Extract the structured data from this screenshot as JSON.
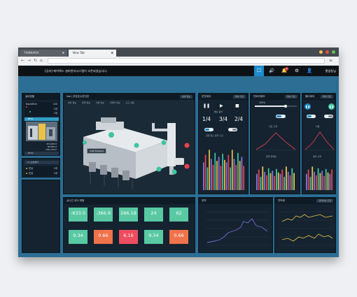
{
  "browser": {
    "tabs": [
      {
        "label": "THINKARIX",
        "close": "✖"
      },
      {
        "label": "New Tab",
        "close": "✖"
      }
    ],
    "window_controls": {
      "colors": [
        "#f5bd4f",
        "#e9504a",
        "#60c153"
      ]
    }
  },
  "header": {
    "notice": "[공지] 에어텍스 설비관리시스템이 오픈되었습니다.",
    "notification_count": "1",
    "user": "홍길동님"
  },
  "left_panel": {
    "title": "설비현황",
    "summary": [
      {
        "label": "Backfilter",
        "value": "100"
      },
      {
        "label": "",
        "value": "1대"
      },
      {
        "label": "",
        "value": "1대"
      }
    ],
    "items": [
      {
        "label": "BF01"
      },
      {
        "label": "BF02"
      }
    ],
    "info_lines": [
      {
        "label": "",
        "value": "BF10B703"
      },
      {
        "label": "",
        "value": "MK3B703"
      },
      {
        "label": "",
        "value": "2020.08.02"
      }
    ],
    "group_title": "LF_보호필터",
    "group_items": [
      {
        "label": "운남",
        "value": "1대"
      },
      {
        "label": "운남",
        "value": "1대"
      }
    ]
  },
  "center_panel": {
    "title": "No1_부영호수운전컨",
    "btn": "설비 정보",
    "toolbar": [
      "필터 정보",
      "압력 정보",
      "차압 정보",
      "인버터 정보",
      "출고 이동"
    ],
    "tooltip": "Inlet Pressure",
    "realtime_title": "실시간 센서 현황",
    "cards": [
      {
        "label": "",
        "value": "-633.0",
        "color": "#58c9a3"
      },
      {
        "label": "",
        "value": "-366.9",
        "color": "#58c9a3"
      },
      {
        "label": "",
        "value": "266.18",
        "color": "#58c9a3"
      },
      {
        "label": "",
        "value": "24",
        "color": "#58c9a3"
      },
      {
        "label": "",
        "value": "62",
        "color": "#58c9a3"
      },
      {
        "label": "",
        "value": "9.34",
        "color": "#58c9a3"
      },
      {
        "label": "",
        "value": "0.66",
        "color": "#f0734b"
      },
      {
        "label": "",
        "value": "6.16",
        "color": "#ee4d5f"
      },
      {
        "label": "",
        "value": "9.34",
        "color": "#58c9a3"
      },
      {
        "label": "",
        "value": "0.66",
        "color": "#f0734b"
      }
    ]
  },
  "operation_panel": {
    "title": "운전제어",
    "btn": "제어 기준",
    "fractions": [
      "1/4",
      "3/4",
      "2/4"
    ],
    "subtitle": "밸브 동작",
    "chart_title": "금일 펄스 동작 시간"
  },
  "inverter_panel": {
    "title": "인버터제어",
    "btn": "제어 기준",
    "percent": "100%",
    "chart1_title": "차트 출력",
    "chart2_title": "압력 현재값"
  },
  "valve_panel": {
    "title": "필터제어",
    "btn": "제어 기준",
    "chart1_title": "차압",
    "chart2_title": "필터 출력"
  },
  "trend_panel": {
    "title": "압력",
    "x_labels": [
      "",
      "",
      "",
      "",
      "",
      "",
      ""
    ]
  },
  "pressure_panel": {
    "title": "전력량",
    "btn": "전력이상 조회"
  },
  "colors": {
    "accent": "#1e8bcc",
    "panel": "#152330",
    "page": "#2c6e94"
  }
}
